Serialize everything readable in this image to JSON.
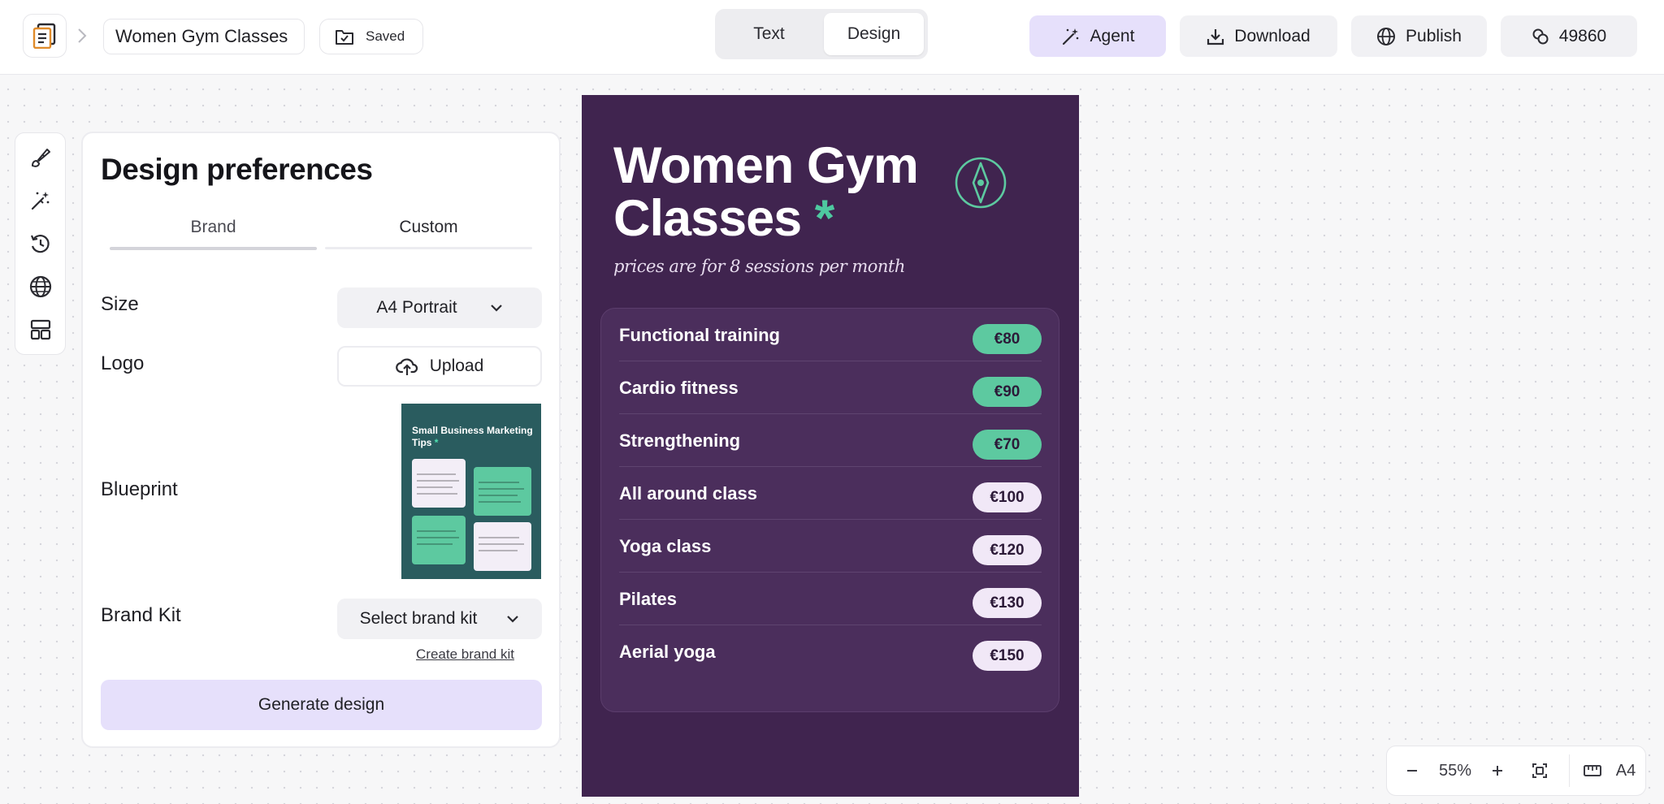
{
  "header": {
    "doc_title": "Women Gym Classes",
    "saved_label": "Saved",
    "mode_tabs": [
      "Text",
      "Design"
    ],
    "active_mode": "Design",
    "agent_label": "Agent",
    "download_label": "Download",
    "publish_label": "Publish",
    "credits": "49860"
  },
  "rail": {
    "icons": [
      "paintbrush-icon",
      "magic-wand-icon",
      "history-icon",
      "globe-icon",
      "layout-icon"
    ]
  },
  "panel": {
    "title": "Design preferences",
    "tabs": [
      "Brand",
      "Custom"
    ],
    "size_label": "Size",
    "size_value": "A4 Portrait",
    "logo_label": "Logo",
    "upload_label": "Upload",
    "blueprint_label": "Blueprint",
    "blueprint_thumb_title": "Small Business Marketing Tips",
    "brand_kit_label": "Brand Kit",
    "brand_kit_value": "Select brand kit",
    "create_brand_kit": "Create brand kit",
    "generate_label": "Generate design"
  },
  "poster": {
    "title": "Women Gym Classes",
    "title_asterisk": "*",
    "subtitle": "prices are for 8 sessions per month",
    "colors": {
      "background": "#40244f",
      "accent_green": "#5dc9a0",
      "badge_light": "#f1e8f7"
    },
    "items": [
      {
        "name": "Functional training",
        "price": "€80",
        "style": "green"
      },
      {
        "name": "Cardio fitness",
        "price": "€90",
        "style": "green"
      },
      {
        "name": "Strengthening",
        "price": "€70",
        "style": "green"
      },
      {
        "name": "All around class",
        "price": "€100",
        "style": "light"
      },
      {
        "name": "Yoga class",
        "price": "€120",
        "style": "light"
      },
      {
        "name": "Pilates",
        "price": "€130",
        "style": "light"
      },
      {
        "name": "Aerial yoga",
        "price": "€150",
        "style": "light"
      }
    ]
  },
  "zoom": {
    "level": "55%",
    "page_size": "A4"
  }
}
